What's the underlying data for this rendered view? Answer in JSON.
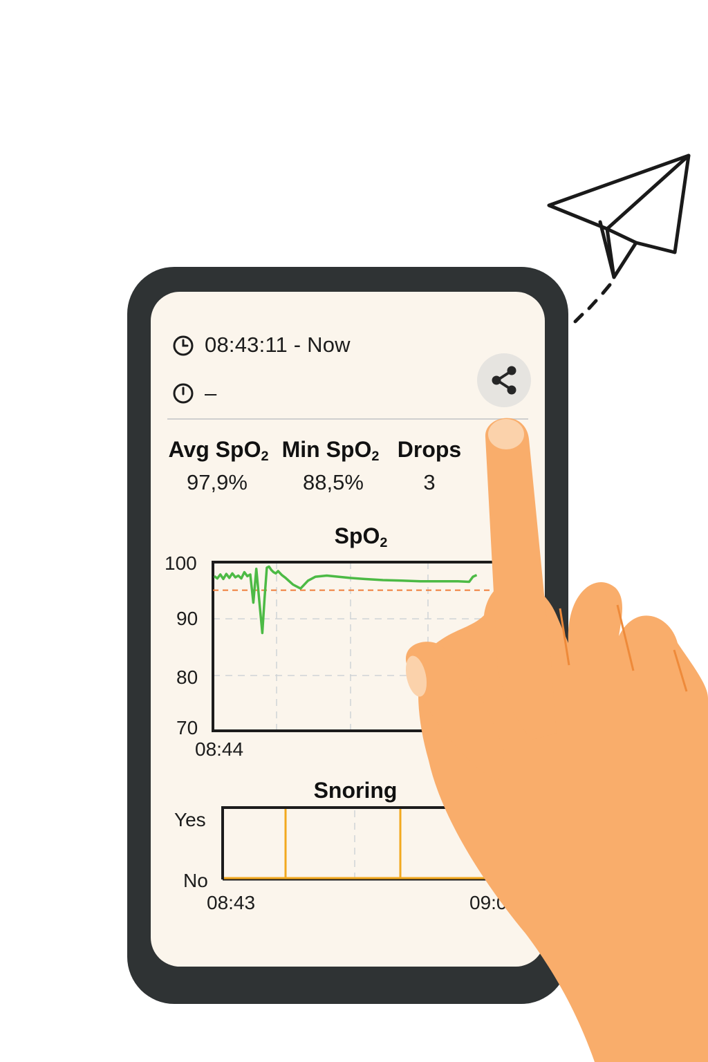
{
  "session": {
    "time_range": "08:43:11 - Now",
    "duration": "–"
  },
  "stats": [
    {
      "label_main": "Avg SpO",
      "label_sub": "2",
      "value": "97,9%"
    },
    {
      "label_main": "Min SpO",
      "label_sub": "2",
      "value": "88,5%"
    },
    {
      "label_main": "Drops",
      "label_sub": "",
      "value": "3"
    }
  ],
  "icons": {
    "clock": "clock-icon",
    "timer": "timer-icon",
    "share": "share-icon",
    "paper_plane": "paper-plane-icon"
  },
  "colors": {
    "spo2_line": "#4cba45",
    "threshold": "#ef7d3a",
    "snoring": "#f2a91f",
    "hand": "#f9ad6b"
  },
  "chart_data": [
    {
      "type": "line",
      "title_main": "SpO",
      "title_sub": "2",
      "ylim": [
        70,
        100
      ],
      "yticks": [
        "100",
        "90",
        "80",
        "70"
      ],
      "xtick_left": "08:44",
      "threshold": 95,
      "series": [
        {
          "x": [
            0,
            0.8,
            1.6,
            2.4,
            3.2,
            4.0,
            4.8,
            5.6,
            6.4,
            7.2,
            8.0,
            8.8,
            9.6,
            10.4,
            11.2,
            12.0,
            12.8,
            13.4,
            14.0,
            14.6,
            15.2,
            15.8,
            16.4,
            17.0,
            18.0,
            19.0,
            20.0,
            21.0,
            23.0,
            25.0,
            27.0,
            30.0,
            33.0,
            36.0,
            40.0,
            45.0,
            50.0,
            55.0,
            60.0,
            65.0,
            68.0,
            69.0,
            70.0
          ],
          "y": [
            97.5,
            97.1,
            97.8,
            97.0,
            97.9,
            97.2,
            98.0,
            97.3,
            97.6,
            97.1,
            98.2,
            97.5,
            97.8,
            92.8,
            98.8,
            93.0,
            87.4,
            93.5,
            99.0,
            99.2,
            98.6,
            98.2,
            98.0,
            98.4,
            97.7,
            97.2,
            96.6,
            96.0,
            95.3,
            96.7,
            97.4,
            97.6,
            97.4,
            97.2,
            97.0,
            96.8,
            96.7,
            96.6,
            96.6,
            96.6,
            96.5,
            97.4,
            97.7
          ]
        }
      ]
    },
    {
      "type": "line",
      "title": "Snoring",
      "yticks": [
        "Yes",
        "No"
      ],
      "xtick_left": "08:43",
      "xtick_right": "09:0"
    }
  ]
}
